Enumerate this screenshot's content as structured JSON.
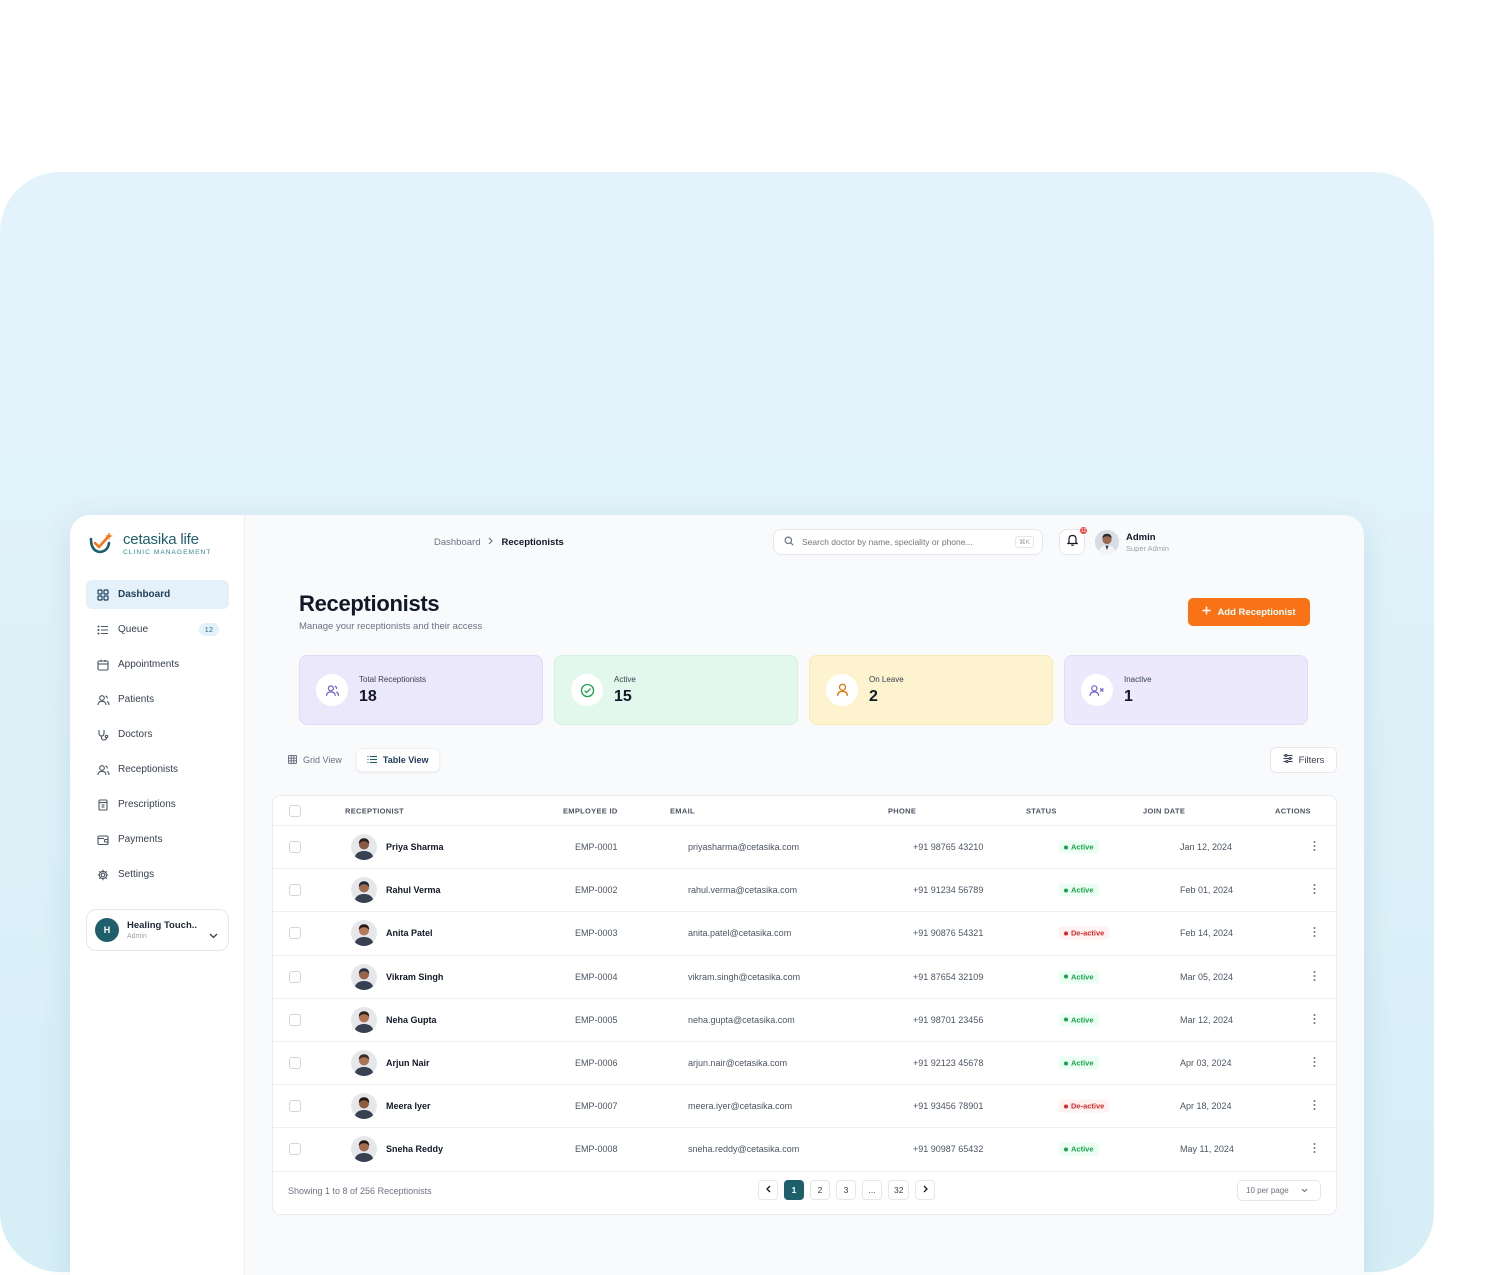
{
  "brand": {
    "name": "cetasika life",
    "tagline": "CLINIC MANAGEMENT"
  },
  "sidebar": {
    "items": [
      {
        "label": "Dashboard",
        "icon": "grid-icon",
        "active": true
      },
      {
        "label": "Queue",
        "icon": "list-icon",
        "badge": "12"
      },
      {
        "label": "Appointments",
        "icon": "calendar-icon"
      },
      {
        "label": "Patients",
        "icon": "users-icon"
      },
      {
        "label": "Doctors",
        "icon": "stethoscope-icon"
      },
      {
        "label": "Receptionists",
        "icon": "users-icon"
      },
      {
        "label": "Prescriptions",
        "icon": "clipboard-icon"
      },
      {
        "label": "Payments",
        "icon": "wallet-icon"
      },
      {
        "label": "Settings",
        "icon": "gear-icon"
      }
    ],
    "clinic": {
      "initial": "H",
      "name": "Healing Touch..",
      "role": "Admin"
    }
  },
  "header": {
    "breadcrumb": {
      "parent": "Dashboard",
      "current": "Receptionists"
    },
    "search_placeholder": "Search doctor by name, speciality or phone...",
    "search_shortcut": "⌘K",
    "notification_count": "12",
    "user": {
      "name": "Admin",
      "role": "Super Admin"
    }
  },
  "page": {
    "title": "Receptionists",
    "subtitle": "Manage your receptionists and their access",
    "add_button": "Add Receptionist"
  },
  "stats": [
    {
      "label": "Total Receptionists",
      "value": "18",
      "bg": "#ece8fb",
      "border": "#e1dbf7",
      "icon": "users-icon",
      "icon_color": "#6d5bd0"
    },
    {
      "label": "Active",
      "value": "15",
      "bg": "#e3f8ec",
      "border": "#d2f1df",
      "icon": "check-circle-icon",
      "icon_color": "#16a34a"
    },
    {
      "label": "On Leave",
      "value": "2",
      "bg": "#fdf3cf",
      "border": "#f8e9b4",
      "icon": "user-icon",
      "icon_color": "#d97706"
    },
    {
      "label": "Inactive",
      "value": "1",
      "bg": "#ebe9fb",
      "border": "#e0ddf7",
      "icon": "user-x-icon",
      "icon_color": "#6d5bd0"
    }
  ],
  "views": {
    "grid": "Grid View",
    "table": "Table View"
  },
  "filters_label": "Filters",
  "table": {
    "columns": {
      "receptionist": "RECEPTIONIST",
      "employee_id": "EMPLOYEE ID",
      "email": "EMAIL",
      "phone": "PHONE",
      "status": "STATUS",
      "join_date": "JOIN DATE",
      "actions": "ACTIONS"
    },
    "rows": [
      {
        "name": "Priya Sharma",
        "id": "EMP-0001",
        "email": "priyasharma@cetasika.com",
        "phone": "+91 98765 43210",
        "status": "Active",
        "ok": true,
        "date": "Jan 12, 2024",
        "skin": "#8a5a44",
        "hair": "#2b1d16"
      },
      {
        "name": "Rahul Verma",
        "id": "EMP-0002",
        "email": "rahul.verma@cetasika.com",
        "phone": "+91 91234 56789",
        "status": "Active",
        "ok": true,
        "date": "Feb 01, 2024",
        "skin": "#a06a4c",
        "hair": "#1f2a38"
      },
      {
        "name": "Anita Patel",
        "id": "EMP-0003",
        "email": "anita.patel@cetasika.com",
        "phone": "+91 90876 54321",
        "status": "De-active",
        "ok": false,
        "date": "Feb 14, 2024",
        "skin": "#b57a58",
        "hair": "#2a1a12"
      },
      {
        "name": "Vikram Singh",
        "id": "EMP-0004",
        "email": "vikram.singh@cetasika.com",
        "phone": "+91 87654 32109",
        "status": "Active",
        "ok": true,
        "date": "Mar 05, 2024",
        "skin": "#9a6648",
        "hair": "#25303f"
      },
      {
        "name": "Neha Gupta",
        "id": "EMP-0005",
        "email": "neha.gupta@cetasika.com",
        "phone": "+91 98701 23456",
        "status": "Active",
        "ok": true,
        "date": "Mar 12, 2024",
        "skin": "#b07454",
        "hair": "#2f2018"
      },
      {
        "name": "Arjun Nair",
        "id": "EMP-0006",
        "email": "arjun.nair@cetasika.com",
        "phone": "+91 92123 45678",
        "status": "Active",
        "ok": true,
        "date": "Apr 03, 2024",
        "skin": "#a87556",
        "hair": "#3a2a20"
      },
      {
        "name": "Meera Iyer",
        "id": "EMP-0007",
        "email": "meera.iyer@cetasika.com",
        "phone": "+91 93456 78901",
        "status": "De-active",
        "ok": false,
        "date": "Apr 18, 2024",
        "skin": "#8f5c42",
        "hair": "#1d1410"
      },
      {
        "name": "Sneha Reddy",
        "id": "EMP-0008",
        "email": "sneha.reddy@cetasika.com",
        "phone": "+91 90987 65432",
        "status": "Active",
        "ok": true,
        "date": "May 11, 2024",
        "skin": "#a46c4e",
        "hair": "#241812"
      }
    ]
  },
  "footer": {
    "summary": "Showing 1 to 8 of 256 Receptionists",
    "pages": [
      "1",
      "2",
      "3",
      "...",
      "32"
    ],
    "current_page": "1",
    "per_page": "10 per page"
  },
  "colors": {
    "accent": "#f97316",
    "brand": "#1f5f6b",
    "active_status": "#16a34a",
    "inactive_status": "#dc2626"
  }
}
